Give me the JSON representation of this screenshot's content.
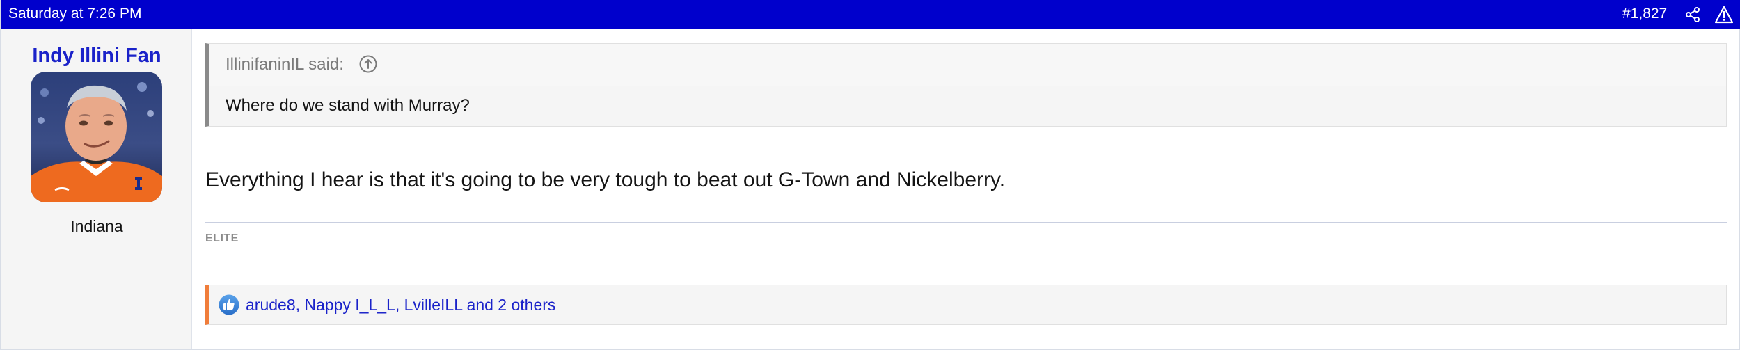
{
  "header": {
    "date": "Saturday at 7:26 PM",
    "post_number": "#1,827",
    "share_icon": "share-icon",
    "report_icon": "warning-icon"
  },
  "user": {
    "name": "Indy Illini Fan",
    "location": "Indiana"
  },
  "quote": {
    "attribution": "IllinifaninIL said:",
    "text": "Where do we stand with Murray?"
  },
  "post": {
    "body": "Everything I hear is that it's going to be very tough to beat out G-Town and Nickelberry.",
    "signature_label": "ELITE"
  },
  "reactions": {
    "text": "arude8, Nappy I_L_L, LvilleILL and 2 others",
    "icon": "thumbs-up-icon"
  },
  "colors": {
    "header_bg": "#0000cc",
    "username": "#1a22c9",
    "reaction_accent": "#f07d3a"
  }
}
